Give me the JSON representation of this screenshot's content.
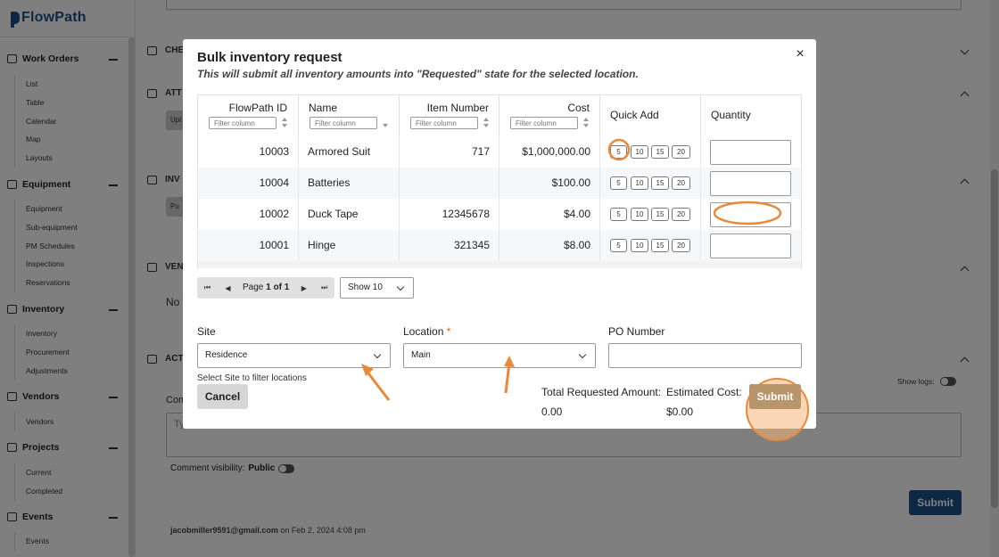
{
  "app": {
    "brand": "FlowPath"
  },
  "sidebar": {
    "groups": [
      {
        "label": "Work Orders",
        "items": [
          "List",
          "Table",
          "Calendar",
          "Map",
          "Layouts"
        ]
      },
      {
        "label": "Equipment",
        "items": [
          "Equipment",
          "Sub-equipment",
          "PM Schedules",
          "Inspections",
          "Reservations"
        ]
      },
      {
        "label": "Inventory",
        "items": [
          "Inventory",
          "Procurement",
          "Adjustments"
        ]
      },
      {
        "label": "Vendors",
        "items": [
          "Vendors"
        ]
      },
      {
        "label": "Projects",
        "items": [
          "Current",
          "Completed"
        ]
      },
      {
        "label": "Events",
        "items": [
          "Events"
        ]
      }
    ]
  },
  "background": {
    "sections": [
      "CHE",
      "ATT",
      "INV",
      "VEN",
      "ACT"
    ],
    "upload_stub": "Upl",
    "pu_stub": "Pu",
    "no_stub": "No V",
    "comment_label": "Comm",
    "comment_placeholder": "Ty",
    "visibility_label": "Comment visibility:",
    "visibility_value": "Public",
    "show_logs": "Show logs:",
    "submit": "Submit",
    "email": "jacobmiller9591@gmail.com",
    "email_suffix": "on Feb 2, 2024 4:08 pm"
  },
  "modal": {
    "title": "Bulk inventory request",
    "subtitle": "This will submit all inventory amounts into \"Requested\" state for the selected location.",
    "close": "×",
    "columns": {
      "id": "FlowPath ID",
      "name": "Name",
      "item_number": "Item Number",
      "cost": "Cost",
      "quick_add": "Quick Add",
      "quantity": "Quantity"
    },
    "filter_placeholder": "Filter column",
    "quick_add_values": [
      "5",
      "10",
      "15",
      "20"
    ],
    "rows": [
      {
        "id": "10003",
        "name": "Armored Suit",
        "item_number": "717",
        "cost": "$1,000,000.00"
      },
      {
        "id": "10004",
        "name": "Batteries",
        "item_number": "",
        "cost": "$100.00"
      },
      {
        "id": "10002",
        "name": "Duck Tape",
        "item_number": "12345678",
        "cost": "$4.00"
      },
      {
        "id": "10001",
        "name": "Hinge",
        "item_number": "321345",
        "cost": "$8.00"
      }
    ],
    "pager": {
      "page_prefix": "Page",
      "page_current": "1 of 1",
      "show": "Show 10"
    },
    "site": {
      "label": "Site",
      "value": "Residence",
      "hint": "Select Site to filter locations"
    },
    "location": {
      "label": "Location",
      "required_mark": "*",
      "value": "Main"
    },
    "po": {
      "label": "PO Number",
      "value": ""
    },
    "cancel": "Cancel",
    "total_label": "Total Requested Amount:",
    "total_value": "0.00",
    "estimated_label": "Estimated Cost:",
    "estimated_value": "$0.00",
    "submit": "Submit"
  },
  "colors": {
    "brand": "#1d4e89",
    "annotation": "#e8893a"
  }
}
